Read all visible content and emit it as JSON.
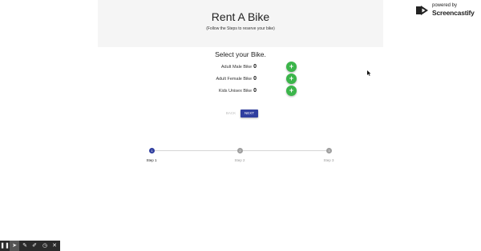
{
  "header": {
    "title": "Rent A Bike",
    "subtitle": "(Follow the Steps to reserve your bike)"
  },
  "watermark": {
    "small": "powered by",
    "brand": "Screencastify"
  },
  "section_title": "Select your Bike.",
  "bikes": [
    {
      "label": "Adult Male Bike",
      "count": "0"
    },
    {
      "label": "Adult Female Bike",
      "count": "0"
    },
    {
      "label": "Kids Unisex Bike",
      "count": "0"
    }
  ],
  "add_button_symbol": "+",
  "buttons": {
    "back": "BACK",
    "next": "NEXT"
  },
  "steps": [
    {
      "number": "1",
      "label": "Step 1",
      "active": true
    },
    {
      "number": "2",
      "label": "Step 2",
      "active": false
    },
    {
      "number": "3",
      "label": "Step 3",
      "active": false
    }
  ],
  "colors": {
    "primary": "#303f9f",
    "add_button": "#3bb54a",
    "inactive_step": "#9e9e9e",
    "header_bg": "#f5f5f5",
    "toolbar_bg": "#2b2b2b"
  },
  "toolbar": {
    "tools": [
      "pause-icon",
      "cursor-icon",
      "pen-icon",
      "highlighter-icon",
      "timer-icon",
      "close-icon"
    ],
    "glyphs": [
      "❚❚",
      "➤",
      "✎",
      "✐",
      "◷",
      "✕"
    ]
  }
}
